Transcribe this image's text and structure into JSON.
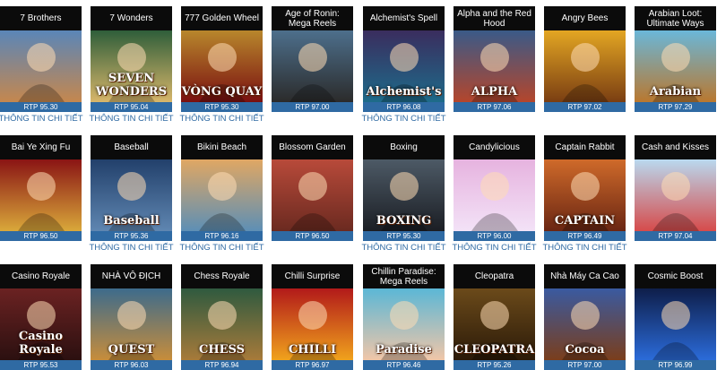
{
  "detail_link_label": "THÔNG TIN CHI TIẾT",
  "games": [
    {
      "title": "7 Brothers",
      "rtp": "RTP 95.30",
      "art_text": "",
      "bg": [
        "#5a86b8",
        "#c5874e"
      ],
      "detail": true
    },
    {
      "title": "7 Wonders",
      "rtp": "RTP 95.04",
      "art_text": "SEVEN WONDERS",
      "bg": [
        "#2f5e3a",
        "#d8b66a"
      ],
      "detail": true
    },
    {
      "title": "777 Golden Wheel",
      "rtp": "RTP 95.30",
      "art_text": "VÒNG QUAY",
      "bg": [
        "#b8872c",
        "#7a1010"
      ],
      "detail": true
    },
    {
      "title": "Age of Ronin: Mega Reels",
      "rtp": "RTP 97.00",
      "art_text": "",
      "bg": [
        "#4d6f8c",
        "#2b2b2b"
      ],
      "detail": false
    },
    {
      "title": "Alchemist's Spell",
      "rtp": "RTP 96.08",
      "art_text": "Alchemist's",
      "bg": [
        "#3a2d5e",
        "#1e6b8a"
      ],
      "detail": true
    },
    {
      "title": "Alpha and the Red Hood",
      "rtp": "RTP 97.06",
      "art_text": "ALPHA",
      "bg": [
        "#3a5a88",
        "#b4462c"
      ],
      "detail": false
    },
    {
      "title": "Angry Bees",
      "rtp": "RTP 97.02",
      "art_text": "",
      "bg": [
        "#e3a623",
        "#7a3e12"
      ],
      "detail": false
    },
    {
      "title": "Arabian Loot: Ultimate Ways",
      "rtp": "RTP 97.29",
      "art_text": "Arabian",
      "bg": [
        "#6ab7d9",
        "#b9782f"
      ],
      "detail": false
    },
    {
      "title": "Bai Ye Xing Fu",
      "rtp": "RTP 96.50",
      "art_text": "",
      "bg": [
        "#8a1414",
        "#d9a83a"
      ],
      "detail": false
    },
    {
      "title": "Baseball",
      "rtp": "RTP 95.36",
      "art_text": "Baseball",
      "bg": [
        "#22406b",
        "#5f86b1"
      ],
      "detail": true
    },
    {
      "title": "Bikini Beach",
      "rtp": "RTP 96.16",
      "art_text": "",
      "bg": [
        "#e0a763",
        "#5d8fb5"
      ],
      "detail": true
    },
    {
      "title": "Blossom Garden",
      "rtp": "RTP 96.50",
      "art_text": "",
      "bg": [
        "#b84a3a",
        "#6b2a20"
      ],
      "detail": false
    },
    {
      "title": "Boxing",
      "rtp": "RTP 95.30",
      "art_text": "BOXING",
      "bg": [
        "#4d5a66",
        "#1b1e24"
      ],
      "detail": true
    },
    {
      "title": "Candylicious",
      "rtp": "RTP 96.00",
      "art_text": "",
      "bg": [
        "#e6b3df",
        "#f3e2f7"
      ],
      "detail": true
    },
    {
      "title": "Captain Rabbit",
      "rtp": "RTP 96.49",
      "art_text": "CAPTAIN",
      "bg": [
        "#cf6a2a",
        "#6a2613"
      ],
      "detail": true
    },
    {
      "title": "Cash and Kisses",
      "rtp": "RTP 97.04",
      "art_text": "",
      "bg": [
        "#b9d9ef",
        "#d64b4b"
      ],
      "detail": false
    },
    {
      "title": "Casino Royale",
      "rtp": "RTP 95.53",
      "art_text": "Casino Royale",
      "bg": [
        "#6b2222",
        "#2b1010"
      ],
      "detail": false
    },
    {
      "title": "NHÀ VÔ ĐỊCH",
      "rtp": "RTP 96.03",
      "art_text": "QUEST",
      "bg": [
        "#3d6b8c",
        "#c78d3b"
      ],
      "detail": false
    },
    {
      "title": "Chess Royale",
      "rtp": "RTP 96.94",
      "art_text": "CHESS",
      "bg": [
        "#2f5a3f",
        "#a77a3a"
      ],
      "detail": false
    },
    {
      "title": "Chilli Surprise",
      "rtp": "RTP 96.97",
      "art_text": "CHILLI",
      "bg": [
        "#b21a1a",
        "#f0a21c"
      ],
      "detail": false
    },
    {
      "title": "Chillin Paradise: Mega Reels",
      "rtp": "RTP 96.46",
      "art_text": "Paradise",
      "bg": [
        "#5bb7d6",
        "#f0c6a8"
      ],
      "detail": false
    },
    {
      "title": "Cleopatra",
      "rtp": "RTP 95.26",
      "art_text": "CLEOPATRA",
      "bg": [
        "#6b4a1a",
        "#2b1a08"
      ],
      "detail": false
    },
    {
      "title": "Nhà Máy Ca Cao",
      "rtp": "RTP 97.00",
      "art_text": "Cocoa",
      "bg": [
        "#3a5aa0",
        "#7a3e1c"
      ],
      "detail": false
    },
    {
      "title": "Cosmic Boost",
      "rtp": "RTP 96.99",
      "art_text": "",
      "bg": [
        "#0e1e4a",
        "#2b6bd9"
      ],
      "detail": false
    }
  ]
}
